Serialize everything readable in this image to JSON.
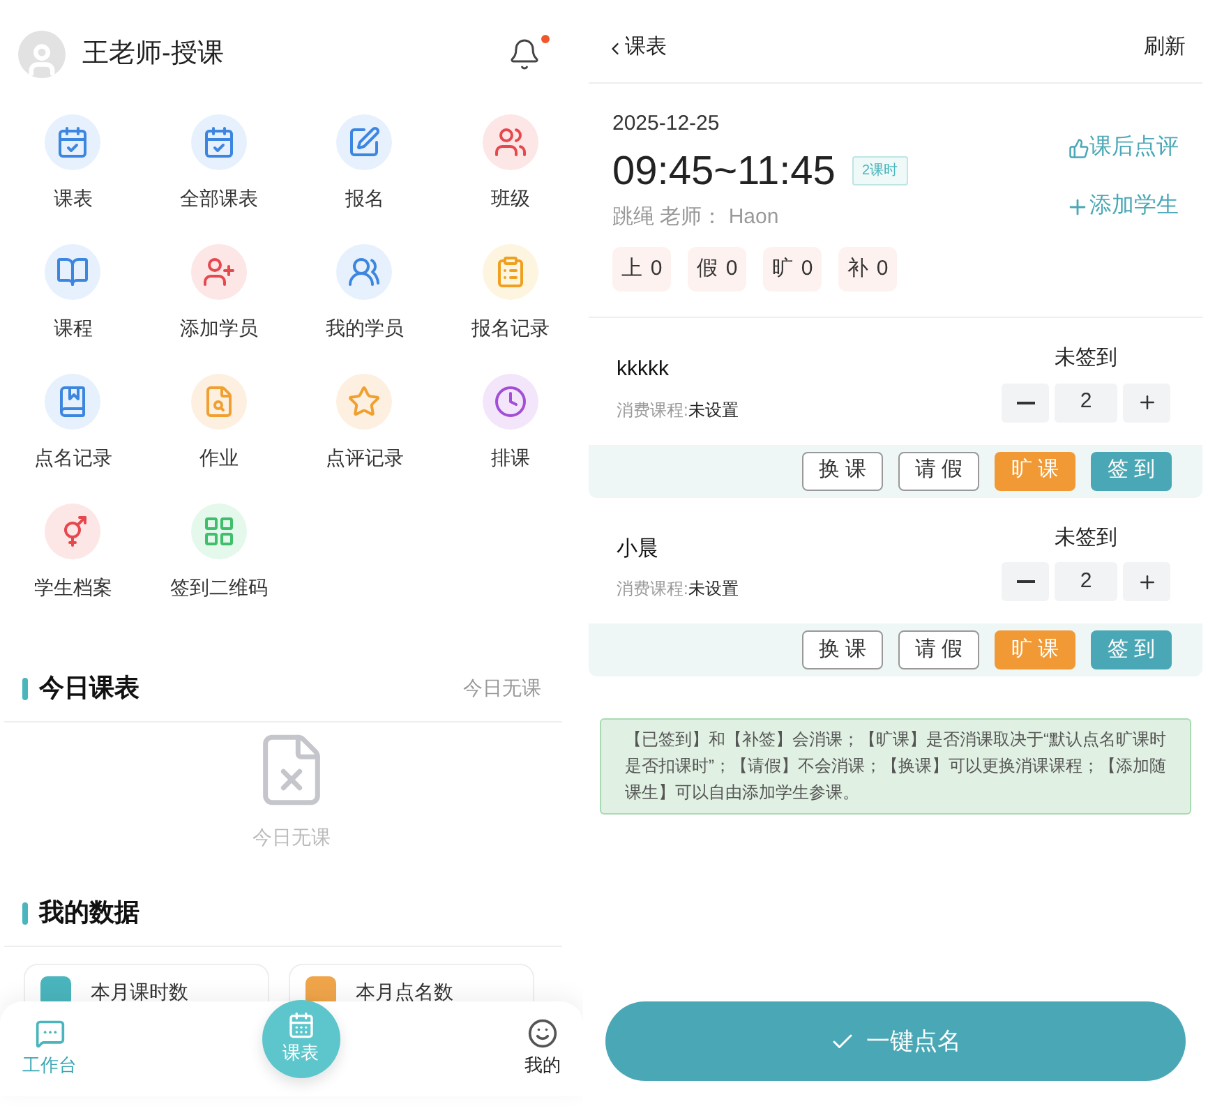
{
  "left": {
    "user": {
      "name": "王老师-授课"
    },
    "notification": {
      "unread": true
    },
    "shortcuts": [
      {
        "label": "课表"
      },
      {
        "label": "全部课表"
      },
      {
        "label": "报名"
      },
      {
        "label": "班级"
      },
      {
        "label": "课程"
      },
      {
        "label": "添加学员"
      },
      {
        "label": "我的学员"
      },
      {
        "label": "报名记录"
      },
      {
        "label": "点名记录"
      },
      {
        "label": "作业"
      },
      {
        "label": "点评记录"
      },
      {
        "label": "排课"
      },
      {
        "label": "学生档案"
      },
      {
        "label": "签到二维码"
      }
    ],
    "today": {
      "title": "今日课表",
      "status": "今日无课",
      "empty_text": "今日无课"
    },
    "my_data": {
      "title": "我的数据",
      "cards": [
        {
          "label": "本月课时数"
        },
        {
          "label": "本月点名数"
        }
      ]
    },
    "bottom_nav": [
      {
        "label": "工作台",
        "selected": true,
        "kind": "tab"
      },
      {
        "label": "课表",
        "selected": false,
        "kind": "center"
      },
      {
        "label": "我的",
        "selected": false,
        "kind": "tab"
      }
    ]
  },
  "right": {
    "header": {
      "back_label": "课表",
      "action": "刷新"
    },
    "lesson": {
      "date": "2025-12-25",
      "time": "09:45~11:45",
      "hours": "2课时",
      "subject_teacher": "跳绳 老师： Haon",
      "actions": [
        "课后点评",
        "添加学生"
      ],
      "counts": [
        {
          "label": "上",
          "value": "0"
        },
        {
          "label": "假",
          "value": "0"
        },
        {
          "label": "旷",
          "value": "0"
        },
        {
          "label": "补",
          "value": "0"
        }
      ]
    },
    "students": [
      {
        "name": "kkkkk",
        "course_label": "消费课程:",
        "course": "未设置",
        "status": "未签到",
        "hours": "2",
        "actions": [
          {
            "label": "换 课",
            "kind": "outline"
          },
          {
            "label": "请 假",
            "kind": "outline"
          },
          {
            "label": "旷 课",
            "kind": "warning"
          },
          {
            "label": "签 到",
            "kind": "primary"
          }
        ]
      },
      {
        "name": "小晨",
        "course_label": "消费课程:",
        "course": "未设置",
        "status": "未签到",
        "hours": "2",
        "actions": [
          {
            "label": "换 课",
            "kind": "outline"
          },
          {
            "label": "请 假",
            "kind": "outline"
          },
          {
            "label": "旷 课",
            "kind": "warning"
          },
          {
            "label": "签 到",
            "kind": "primary"
          }
        ]
      }
    ],
    "notice": "【已签到】和【补签】会消课；【旷课】是否消课取决于“默认点名旷课时是否扣课时”；【请假】不会消课；【换课】可以更换消课课程；【添加随课生】可以自由添加学生参课。",
    "roll_call_button": "一键点名"
  }
}
